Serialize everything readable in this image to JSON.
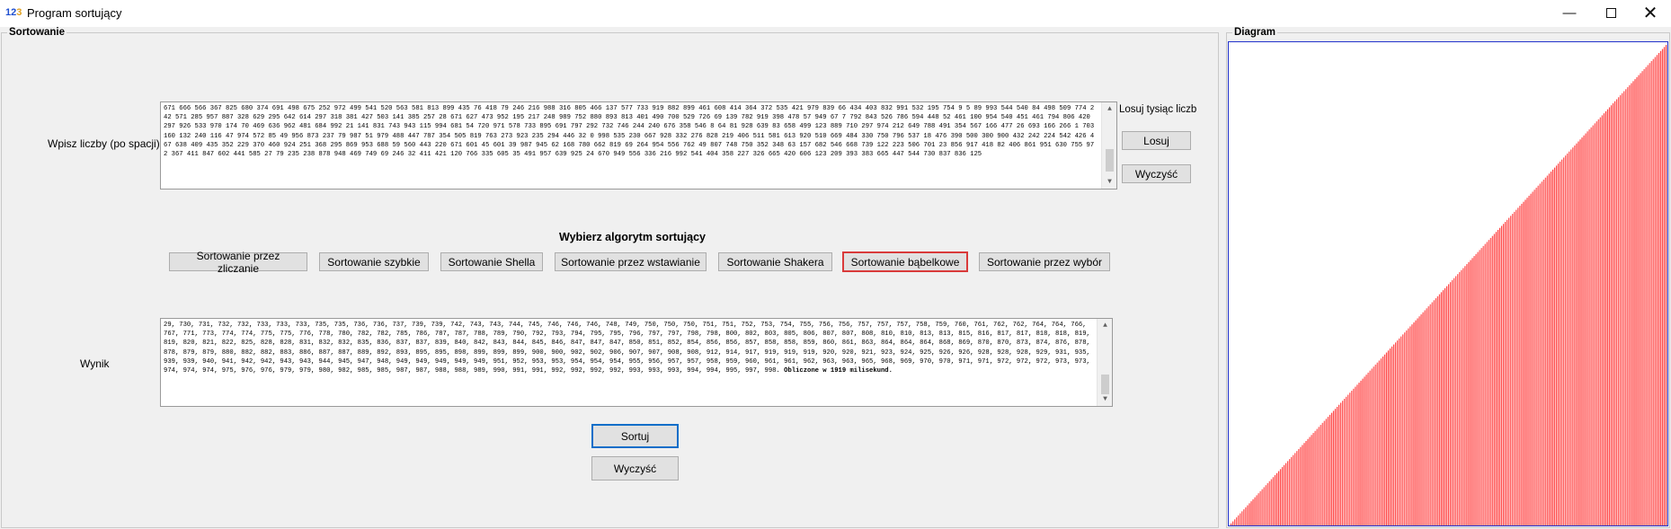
{
  "window": {
    "title": "Program sortujący",
    "icon_text_1": "12",
    "icon_text_2": "3",
    "minimize_icon": "minimize-icon",
    "maximize_icon": "maximize-icon",
    "close_icon": "close-icon"
  },
  "sort_group": {
    "title": "Sortowanie",
    "input_label": "Wpisz liczby (po spacji)",
    "input_value": " 671 666 566 367 825 680 374 691 498 675 252 972 499 541 520 563 581 813 899 435 76 418 79 246 216 988 316 805 466 137 577 733 919 882 899 461 608 414 364 372 535 421 979 839 66 434 403 832 991 532 195 754 9 5 89 993 544 540 84 498 509 774 242 571 285 957 887 328 629 295 642 614 297 318 381 427 503 141 385 257 28 671 627 473 952 195 217 248 989 752 880 893 813 401 490 700 529 726 69 139 782 919 398 478 57 949 67 7 792 843 526 786 594 448 52 461 100 954 540 451 461 794 806 420 297 926 533 970 174 70 469 636 962 481 684 992 21 141 831 743 943 115 994 681 54 720 971 578 733 895 691 797 292 732 746 244 240 676 358 546 8 64 81 928 639 83 658 499 123 889 710 297 974 212 649 788 491 354 567 166 477 26 693 166 266 1 703 160 132 240 116 47 974 572 85 49 956 873 237 79 987 51 979 488 447 787 354 505 819 763 273 923 235 294 446 32 0 998 535 230 667 928 332 276 828 219 406 511 581 613 920 510 669 484 330 750 796 537 18 476 390 500 300 900 432 242 224 542 426 467 638 409 435 352 229 370 460 924 251 368 295 869 953 688 59 560 443 220 671 601 45 601 39 987 945 62 168 780 662 819 69 264 954 556 762 49 807 748 750 352 348 63 157 682 546 668 739 122 223 506 701 23 856 917 418 82 406 861 951 630 755 972 367 411 847 602 441 585 27 79 235 238 878 948 469 749 69 246 32 411 421 120 766 335 605 35 491 957 639 925 24 670 949 556 336 216 992 541 404 358 227 326 665 420 606 123 209 393 383 665 447 544 730 837 836 125",
    "random_label": "Losuj tysiąc liczb",
    "random_button": "Losuj",
    "clear_input_button": "Wyczyść",
    "algorithm_heading": "Wybierz algorytm sortujący",
    "algorithms": [
      "Sortowanie przez zliczanie",
      "Sortowanie szybkie",
      "Sortowanie Shella",
      "Sortowanie przez wstawianie",
      "Sortowanie Shakera",
      "Sortowanie bąbelkowe",
      "Sortowanie przez wybór"
    ],
    "selected_algorithm": "Sortowanie bąbelkowe",
    "result_label": "Wynik",
    "result_value": "29, 730, 731, 732, 732, 733, 733, 733, 735, 735, 736, 736, 737, 739, 739, 742, 743, 743, 744, 745, 746, 746, 746, 748, 749, 750, 750, 750, 751, 751, 752, 753, 754, 755, 756, 756, 757, 757, 757, 758, 759, 760, 761, 762, 762, 764, 764, 766, 767, 771, 773, 774, 774, 775, 775, 776, 778, 780, 782, 782, 785, 786, 787, 787, 788, 789, 790, 792, 793, 794, 795, 795, 796, 797, 797, 798, 798, 800, 802, 803, 805, 806, 807, 807, 808, 810, 810, 813, 813, 815, 816, 817, 817, 818, 818, 819, 819, 820, 821, 822, 825, 828, 828, 831, 832, 832, 835, 836, 837, 837, 839, 840, 842, 843, 844, 845, 846, 847, 847, 847, 850, 851, 852, 854, 856, 856, 857, 858, 858, 859, 860, 861, 863, 864, 864, 864, 868, 869, 870, 870, 873, 874, 876, 878, 878, 879, 879, 880, 882, 882, 883, 886, 887, 887, 889, 892, 893, 895, 895, 898, 899, 899, 899, 900, 900, 902, 902, 906, 907, 907, 908, 908, 912, 914, 917, 919, 919, 919, 920, 920, 921, 923, 924, 925, 926, 926, 928, 928, 928, 929, 931, 935, 939, 939, 940, 941, 942, 942, 943, 943, 944, 945, 947, 948, 949, 949, 949, 949, 949, 951, 952, 953, 953, 954, 954, 954, 955, 956, 957, 957, 958, 959, 960, 961, 961, 962, 963, 963, 965, 968, 969, 970, 970, 971, 971, 972, 972, 972, 973, 973, 974, 974, 974, 975, 976, 976, 979, 979, 980, 982, 985, 985, 987, 987, 988, 988, 989, 990, 991, 991, 992, 992, 992, 992, 993, 993, 993, 994, 994, 995, 997, 998.",
    "result_time_text": " Obliczone w 1919 milisekund.",
    "sort_button": "Sortuj",
    "clear_result_button": "Wyczyść"
  },
  "diagram_group": {
    "title": "Diagram",
    "bar_color": "#ff4444",
    "stripe_color": "#ffd0d0"
  },
  "chart_data": {
    "type": "bar",
    "title": "",
    "xlabel": "",
    "ylabel": "",
    "description_values": "sorted ascending sequence of 1000 random integers 0–1000",
    "count": 1000,
    "ylim": [
      0,
      1000
    ],
    "min_value": 0,
    "max_value": 998,
    "grid": false,
    "legend": "none"
  }
}
